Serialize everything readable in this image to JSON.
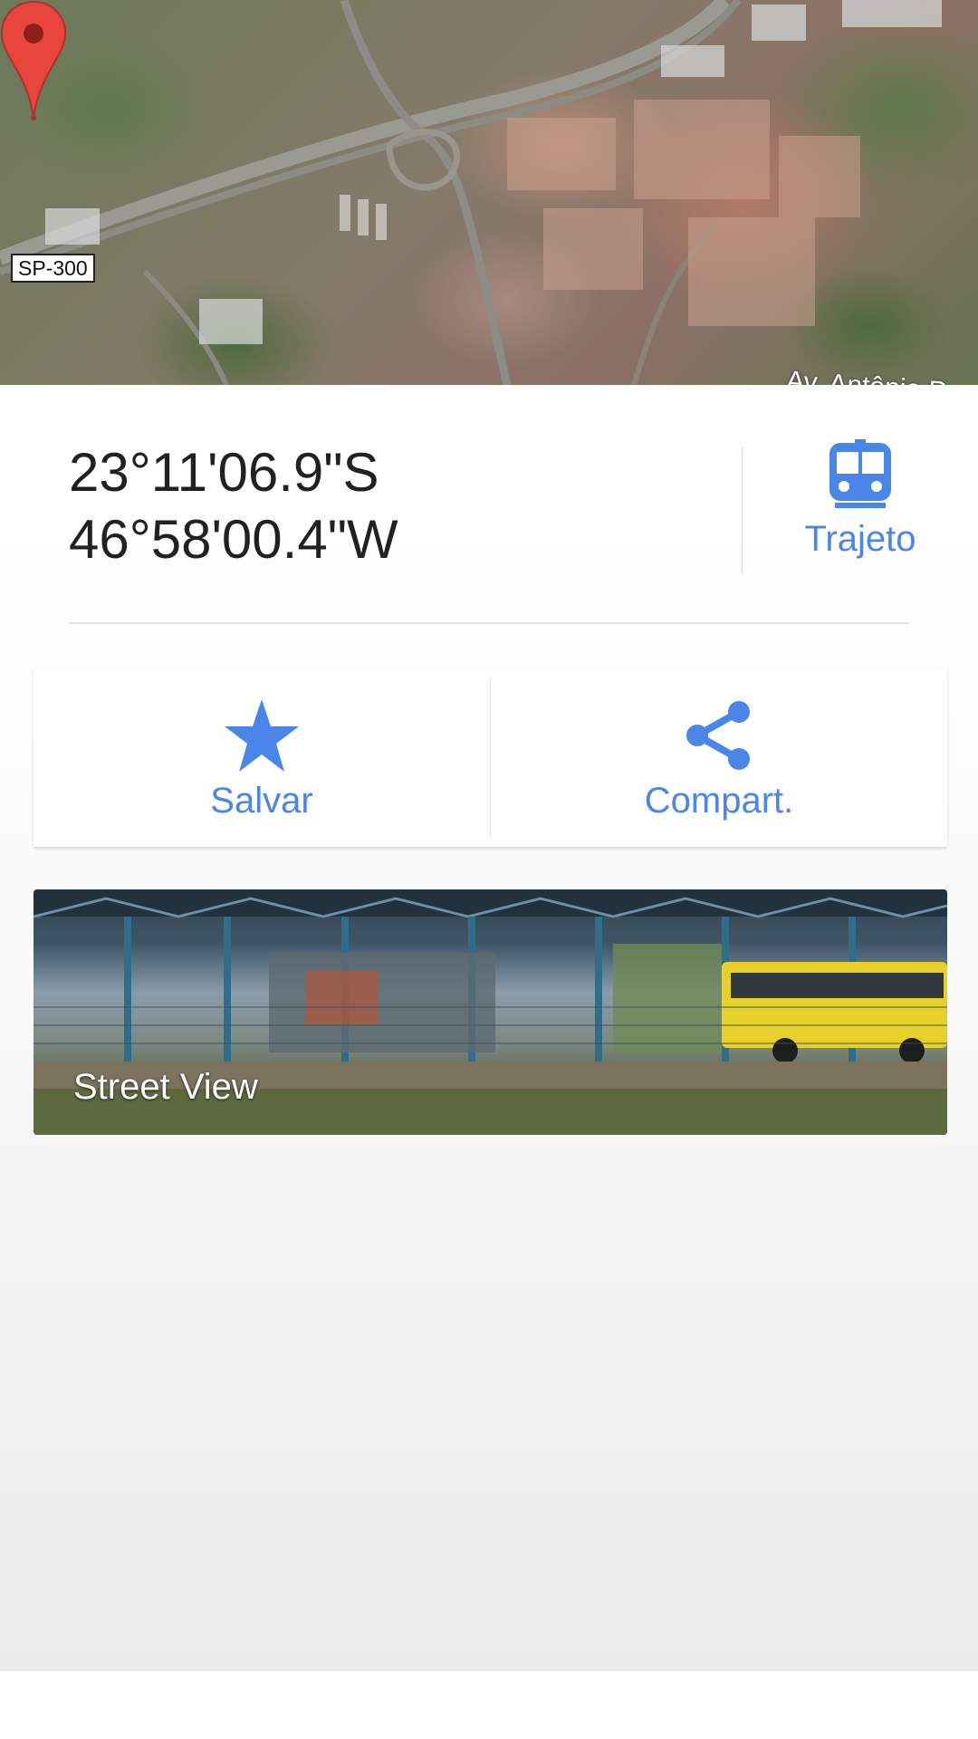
{
  "map": {
    "road_label": "SP-300",
    "street_label": "Av. Antônio P",
    "marker_icon": "map-pin-icon"
  },
  "place": {
    "latitude": "23°11'06.9\"S",
    "longitude": "46°58'00.4\"W"
  },
  "directions": {
    "label": "Trajeto",
    "icon": "transit-bus-icon",
    "color": "#4a86e8"
  },
  "actions": {
    "save_label": "Salvar",
    "save_icon": "star-icon",
    "share_label": "Compart.",
    "share_icon": "share-icon"
  },
  "street_view": {
    "label": "Street View"
  }
}
